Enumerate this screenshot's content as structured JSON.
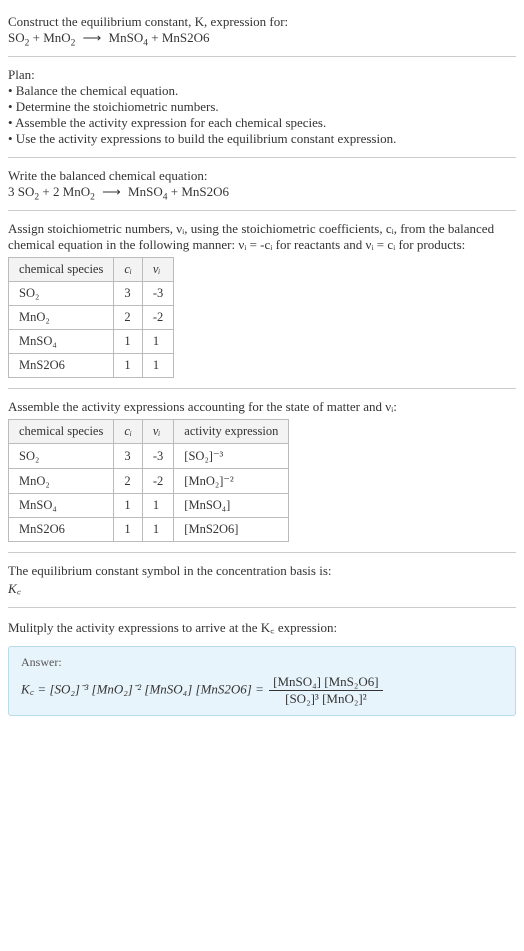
{
  "header": {
    "line1": "Construct the equilibrium constant, K, expression for:",
    "eq_left_1": "SO",
    "eq_left_2": " + MnO",
    "eq_right_1": " MnSO",
    "eq_right_2": " + MnS2O6"
  },
  "plan": {
    "title": "Plan:",
    "b1": "• Balance the chemical equation.",
    "b2": "• Determine the stoichiometric numbers.",
    "b3": "• Assemble the activity expression for each chemical species.",
    "b4": "• Use the activity expressions to build the equilibrium constant expression."
  },
  "balanced": {
    "title": "Write the balanced chemical equation:",
    "c1": "3 SO",
    "c2": " + 2 MnO",
    "c3": " MnSO",
    "c4": " + MnS2O6"
  },
  "assign": {
    "text": "Assign stoichiometric numbers, νᵢ, using the stoichiometric coefficients, cᵢ, from the balanced chemical equation in the following manner: νᵢ = -cᵢ for reactants and νᵢ = cᵢ for products:"
  },
  "table1": {
    "h1": "chemical species",
    "h2": "cᵢ",
    "h3": "νᵢ",
    "rows": [
      {
        "sp": "SO₂",
        "c": "3",
        "v": "-3"
      },
      {
        "sp": "MnO₂",
        "c": "2",
        "v": "-2"
      },
      {
        "sp": "MnSO₄",
        "c": "1",
        "v": "1"
      },
      {
        "sp": "MnS2O6",
        "c": "1",
        "v": "1"
      }
    ]
  },
  "assemble": {
    "text": "Assemble the activity expressions accounting for the state of matter and νᵢ:"
  },
  "table2": {
    "h1": "chemical species",
    "h2": "cᵢ",
    "h3": "νᵢ",
    "h4": "activity expression",
    "rows": [
      {
        "sp": "SO₂",
        "c": "3",
        "v": "-3",
        "a": "[SO₂]⁻³"
      },
      {
        "sp": "MnO₂",
        "c": "2",
        "v": "-2",
        "a": "[MnO₂]⁻²"
      },
      {
        "sp": "MnSO₄",
        "c": "1",
        "v": "1",
        "a": "[MnSO₄]"
      },
      {
        "sp": "MnS2O6",
        "c": "1",
        "v": "1",
        "a": "[MnS2O6]"
      }
    ]
  },
  "symbol": {
    "text": "The equilibrium constant symbol in the concentration basis is:",
    "kc": "K꜀"
  },
  "mult": {
    "text": "Mulitply the activity expressions to arrive at the K꜀ expression:"
  },
  "answer": {
    "label": "Answer:",
    "lhs": "K꜀ = [SO₂]⁻³ [MnO₂]⁻² [MnSO₄] [MnS2O6] = ",
    "num": "[MnSO₄] [MnS₂O6]",
    "den": "[SO₂]³ [MnO₂]²"
  },
  "chart_data": [
    {
      "type": "table",
      "title": "Stoichiometric numbers",
      "columns": [
        "chemical species",
        "c_i",
        "nu_i"
      ],
      "rows": [
        [
          "SO2",
          3,
          -3
        ],
        [
          "MnO2",
          2,
          -2
        ],
        [
          "MnSO4",
          1,
          1
        ],
        [
          "MnS2O6",
          1,
          1
        ]
      ]
    },
    {
      "type": "table",
      "title": "Activity expressions",
      "columns": [
        "chemical species",
        "c_i",
        "nu_i",
        "activity expression"
      ],
      "rows": [
        [
          "SO2",
          3,
          -3,
          "[SO2]^-3"
        ],
        [
          "MnO2",
          2,
          -2,
          "[MnO2]^-2"
        ],
        [
          "MnSO4",
          1,
          1,
          "[MnSO4]"
        ],
        [
          "MnS2O6",
          1,
          1,
          "[MnS2O6]"
        ]
      ]
    }
  ]
}
